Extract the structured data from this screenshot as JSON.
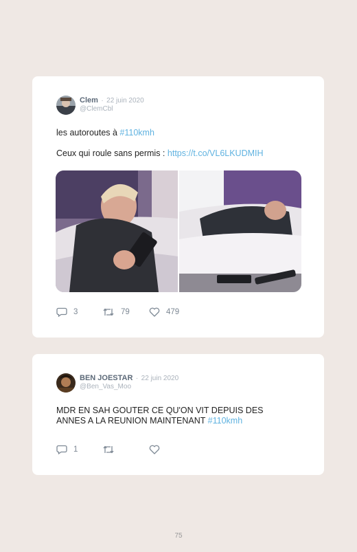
{
  "tweets": [
    {
      "name": "Clem",
      "separator": "·",
      "date": "22 juin 2020",
      "handle": "@ClemCbl",
      "line1_text": "les autoroutes à ",
      "line1_tag": "#110kmh",
      "line2_text": "Ceux qui roule sans permis : ",
      "line2_link": "https://t.co/VL6LKUDMIH",
      "replies": "3",
      "retweets": "79",
      "likes": "479"
    },
    {
      "name": "BEN JOESTAR",
      "separator": "·",
      "date": "22 juin 2020",
      "handle": "@Ben_Vas_Moo",
      "body_text": "MDR EN SAH GOUTER CE QU'ON VIT DEPUIS DES ANNES A LA REUNION MAINTENANT ",
      "body_tag": "#110kmh",
      "replies": "1",
      "retweets": "",
      "likes": ""
    }
  ],
  "page_number": "75",
  "icons": {
    "reply": "reply-icon",
    "retweet": "retweet-icon",
    "like": "heart-icon"
  },
  "colors": {
    "background": "#efe8e4",
    "card": "#ffffff",
    "link": "#5fb2e0",
    "muted": "#aab2bb"
  }
}
